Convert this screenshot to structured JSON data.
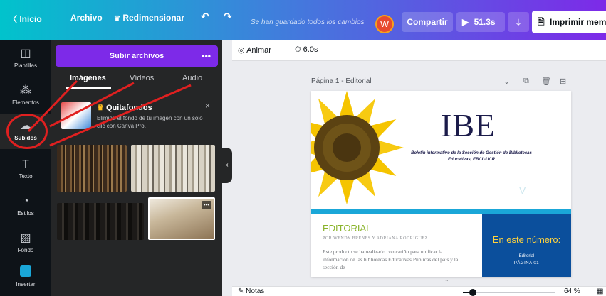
{
  "topbar": {
    "home": "〈  Inicio",
    "file": "Archivo",
    "resize": "Redimensionar",
    "resize_icon": "crown-icon",
    "undo_icon": "undo-icon",
    "redo_icon": "redo-icon",
    "save_status": "Se han guardado todos los cambios",
    "avatar_letter": "W",
    "share": "Compartir",
    "play_time": "51.3s",
    "download_icon": "download-icon",
    "print": "Imprimir memb",
    "gradient_colors": [
      "#01c3cc",
      "#3f7fdc",
      "#7d2ae8"
    ]
  },
  "leftnav": {
    "items": [
      {
        "label": "Plantillas",
        "icon": "templates-icon"
      },
      {
        "label": "Elementos",
        "icon": "elements-icon"
      },
      {
        "label": "Subidos",
        "icon": "upload-cloud-icon"
      },
      {
        "label": "Texto",
        "icon": "text-icon"
      },
      {
        "label": "Estilos",
        "icon": "palette-icon"
      },
      {
        "label": "Fondo",
        "icon": "background-icon"
      },
      {
        "label": "Insertar",
        "icon": "insert-icon"
      }
    ],
    "active": "Subidos"
  },
  "panel": {
    "upload_button": "Subir archivos",
    "upload_more": "•••",
    "tabs": [
      "Imágenes",
      "Vídeos",
      "Audio"
    ],
    "active_tab": "Imágenes",
    "promo": {
      "title": "Quitafondos",
      "description": "Elimina el fondo de tu imagen con un solo clic con Canva Pro.",
      "close": "×"
    },
    "thumb_menu": "•••"
  },
  "subbar": {
    "animate": "Animar",
    "duration": "6.0s"
  },
  "page": {
    "label": "Página 1 - Editorial",
    "title": "IBE",
    "subtitle": "Boletín informativo de la Sección de Gestión de Bibliotecas Educativas, EBCI -UCR",
    "chevron": "V",
    "editorial_title": "EDITORIAL",
    "authors": "POR WENDY BRENES Y ADRIANA RODRÍGUEZ",
    "body": "Este producto se ha realizado con cariño para unificar la información de las bibliotecas Educativas Públicas del país y la sección de",
    "issue_title": "En este número:",
    "issue_item": "Editorial",
    "issue_page": "PÁGINA 01"
  },
  "bottombar": {
    "notes": "Notas",
    "zoom": "64 %",
    "zoom_level": 0.64
  }
}
